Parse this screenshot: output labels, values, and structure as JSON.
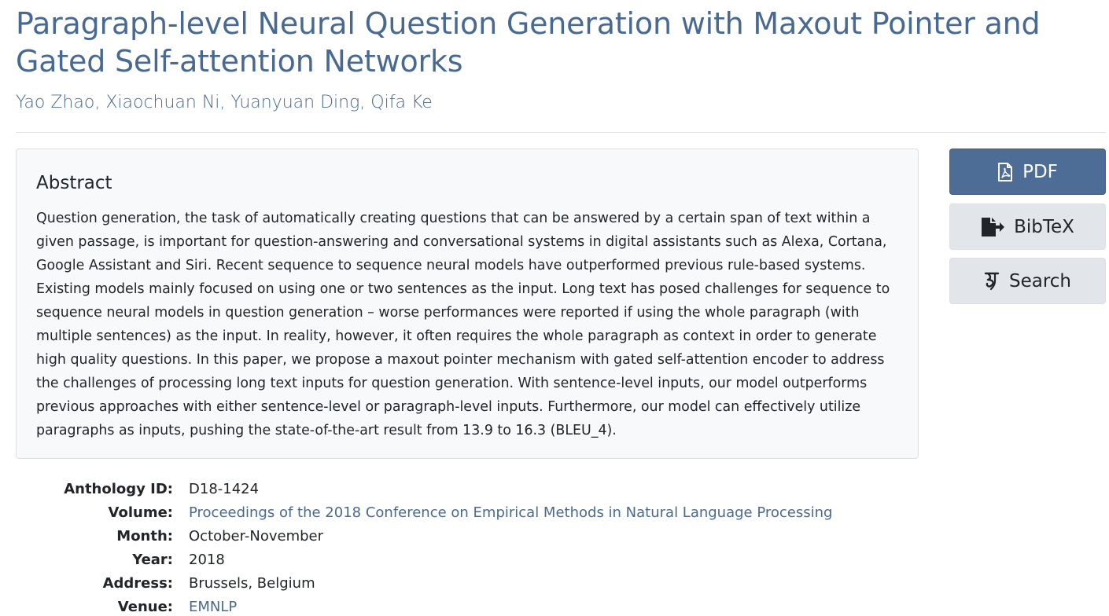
{
  "paper": {
    "title": "Paragraph-level Neural Question Generation with Maxout Pointer and Gated Self-attention Networks",
    "authors": [
      "Yao Zhao",
      "Xiaochuan Ni",
      "Yuanyuan Ding",
      "Qifa Ke"
    ],
    "author_separator": ", "
  },
  "abstract": {
    "heading": "Abstract",
    "text": "Question generation, the task of automatically creating questions that can be answered by a certain span of text within a given passage, is important for question-answering and conversational systems in digital assistants such as Alexa, Cortana, Google Assistant and Siri. Recent sequence to sequence neural models have outperformed previous rule-based systems. Existing models mainly focused on using one or two sentences as the input. Long text has posed challenges for sequence to sequence neural models in question generation – worse performances were reported if using the whole paragraph (with multiple sentences) as the input. In reality, however, it often requires the whole paragraph as context in order to generate high quality questions. In this paper, we propose a maxout pointer mechanism with gated self-attention encoder to address the challenges of processing long text inputs for question generation. With sentence-level inputs, our model outperforms previous approaches with either sentence-level or paragraph-level inputs. Furthermore, our model can effectively utilize paragraphs as inputs, pushing the state-of-the-art result from 13.9 to 16.3 (BLEU_4)."
  },
  "buttons": {
    "pdf": {
      "label": "PDF",
      "icon": "file-pdf-icon"
    },
    "bibtex": {
      "label": "BibTeX",
      "icon": "file-export-icon"
    },
    "search": {
      "label": "Search",
      "icon": "google-scholar-icon"
    }
  },
  "metadata": [
    {
      "key": "Anthology ID:",
      "value": "D18-1424",
      "link": false
    },
    {
      "key": "Volume:",
      "value": "Proceedings of the 2018 Conference on Empirical Methods in Natural Language Processing",
      "link": true
    },
    {
      "key": "Month:",
      "value": "October-November",
      "link": false
    },
    {
      "key": "Year:",
      "value": "2018",
      "link": false
    },
    {
      "key": "Address:",
      "value": "Brussels, Belgium",
      "link": false
    },
    {
      "key": "Venue:",
      "value": "EMNLP",
      "link": true
    }
  ],
  "colors": {
    "link": "#486a92",
    "primary_button": "#4d6d96",
    "secondary_button": "#e2e6ea",
    "card_background": "#f8f9fa"
  }
}
